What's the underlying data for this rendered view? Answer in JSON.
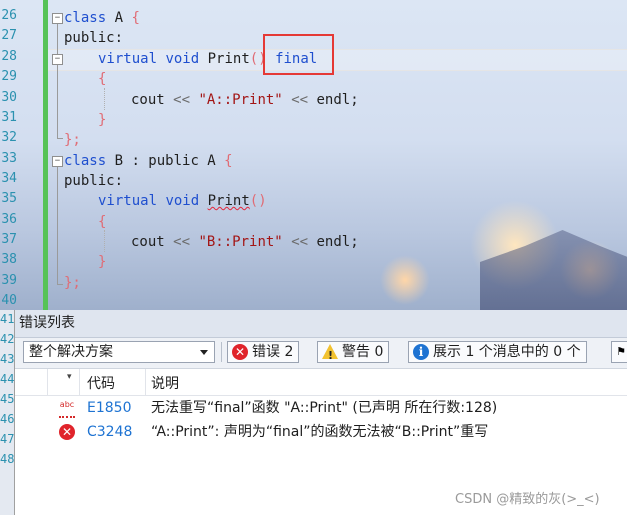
{
  "editor": {
    "line_numbers": [
      "26",
      "27",
      "28",
      "29",
      "30",
      "31",
      "32",
      "33",
      "34",
      "35",
      "36",
      "37",
      "38",
      "39",
      "40"
    ],
    "lines": {
      "l26_kw": "class",
      "l26_name": " A ",
      "l26_brace": "{",
      "l27": "public:",
      "l28_kw1": "virtual",
      "l28_kw2": "void",
      "l28_fn": "Print",
      "l28_paren": "()",
      "l28_final": "final",
      "l29": "{",
      "l30_a": "cout ",
      "l30_op1": "<<",
      "l30_str": "\"A::Print\"",
      "l30_op2": "<<",
      "l30_end": " endl;",
      "l31": "}",
      "l32": "};",
      "l33_kw": "class",
      "l33_name": " B ",
      "l33_rest": ": public A ",
      "l33_brace": "{",
      "l34": "public:",
      "l35_kw1": "virtual",
      "l35_kw2": "void",
      "l35_fn": "Print",
      "l35_paren": "()",
      "l36": "{",
      "l37_a": "cout ",
      "l37_op1": "<<",
      "l37_str": "\"B::Print\"",
      "l37_op2": "<<",
      "l37_end": " endl;",
      "l38": "}",
      "l39": "};"
    },
    "left_strip_numbers": [
      "41",
      "42",
      "43",
      "44",
      "45",
      "46",
      "47",
      "48"
    ]
  },
  "error_list": {
    "title": "错误列表",
    "scope": "整个解决方案",
    "errors_btn": "错误 2",
    "warnings_btn": "警告 0",
    "messages_btn": "展示 1 个消息中的 0 个",
    "col_code": "代码",
    "col_desc": "说明",
    "rows": [
      {
        "icon": "abc-spell-icon",
        "code": "E1850",
        "desc": "无法重写“final”函数 \"A::Print\" (已声明 所在行数:128)"
      },
      {
        "icon": "error-icon",
        "code": "C3248",
        "desc": "“A::Print”: 声明为“final”的函数无法被“B::Print”重写"
      }
    ]
  },
  "watermark": "CSDN @精致的灰(>_<)",
  "colors": {
    "accent_red": "#e53935",
    "change_bar": "#57c357",
    "link_blue": "#1e73d2",
    "keyword_blue": "#1f4fcf"
  }
}
